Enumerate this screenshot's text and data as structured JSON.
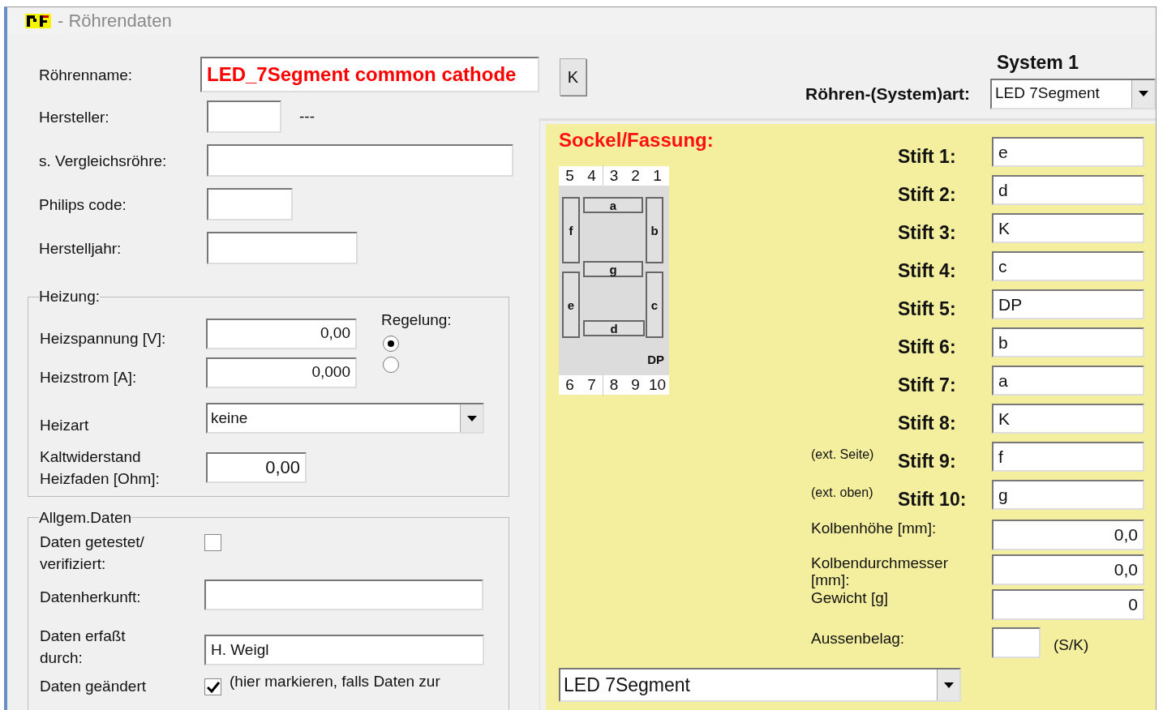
{
  "window": {
    "title": "- Röhrendaten"
  },
  "tube_name": {
    "label": "Röhrenname:",
    "value": "LED_7Segment common cathode",
    "button": "K"
  },
  "fields": [
    {
      "label": "Hersteller:",
      "note": "---"
    },
    {
      "label": "s. Vergleichsröhre:"
    },
    {
      "label": "Philips code:"
    },
    {
      "label": "Herstelljahr:"
    }
  ],
  "heating": {
    "title": "Heizung:",
    "voltage": {
      "label": "Heizspannung [V]:",
      "value": "0,00"
    },
    "current": {
      "label": "Heizstrom [A]:",
      "value": "0,000"
    },
    "regulation": {
      "label": "Regelung:",
      "options": [
        {
          "selected": true
        },
        {
          "selected": false
        }
      ]
    },
    "type": {
      "label": "Heizart",
      "value": "keine"
    },
    "cold_resistance": {
      "label": "Kaltwiderstand\nHeizfaden [Ohm]:",
      "value": "0,00"
    }
  },
  "general": {
    "title": "Allgem.Daten",
    "tested": {
      "label": "Daten getestet/\nverifiziert:",
      "checked": false
    },
    "origin": {
      "label": "Datenherkunft:"
    },
    "entered_by": {
      "label": "Daten erfaßt\ndurch:",
      "value": "H. Weigl"
    },
    "changed": {
      "label": "Daten geändert",
      "checked": true,
      "note": "(hier markieren, falls Daten zur"
    }
  },
  "system": {
    "heading": "System 1",
    "label": "Röhren-(System)art:",
    "value": "LED 7Segment"
  },
  "socket": {
    "title": "Sockel/Fassung:",
    "diagram": {
      "top_pins": [
        "5",
        "4",
        "3",
        "2",
        "1"
      ],
      "bottom_pins": [
        "6",
        "7",
        "8",
        "9",
        "10"
      ],
      "segments": [
        "a",
        "b",
        "c",
        "d",
        "e",
        "f",
        "g"
      ],
      "dp": "DP"
    },
    "pins": [
      {
        "label": "Stift 1:",
        "value": "e"
      },
      {
        "label": "Stift 2:",
        "value": "d"
      },
      {
        "label": "Stift 3:",
        "value": "K"
      },
      {
        "label": "Stift 4:",
        "value": "c"
      },
      {
        "label": "Stift 5:",
        "value": "DP"
      },
      {
        "label": "Stift 6:",
        "value": "b"
      },
      {
        "label": "Stift 7:",
        "value": "a"
      },
      {
        "label": "Stift 8:",
        "value": "K"
      },
      {
        "note": "(ext. Seite)",
        "label": "Stift 9:",
        "value": "f"
      },
      {
        "note": "(ext. oben)",
        "label": "Stift 10:",
        "value": "g"
      }
    ],
    "bulb": [
      {
        "label": "Kolbenhöhe [mm]:",
        "value": "0,0"
      },
      {
        "label": "Kolbendurchmesser\n[mm]:",
        "value": "0,0"
      },
      {
        "label": "Gewicht [g]",
        "value": "0"
      }
    ],
    "coating": {
      "label": "Aussenbelag:",
      "hint": "(S/K)"
    },
    "base_select": "LED 7Segment"
  }
}
